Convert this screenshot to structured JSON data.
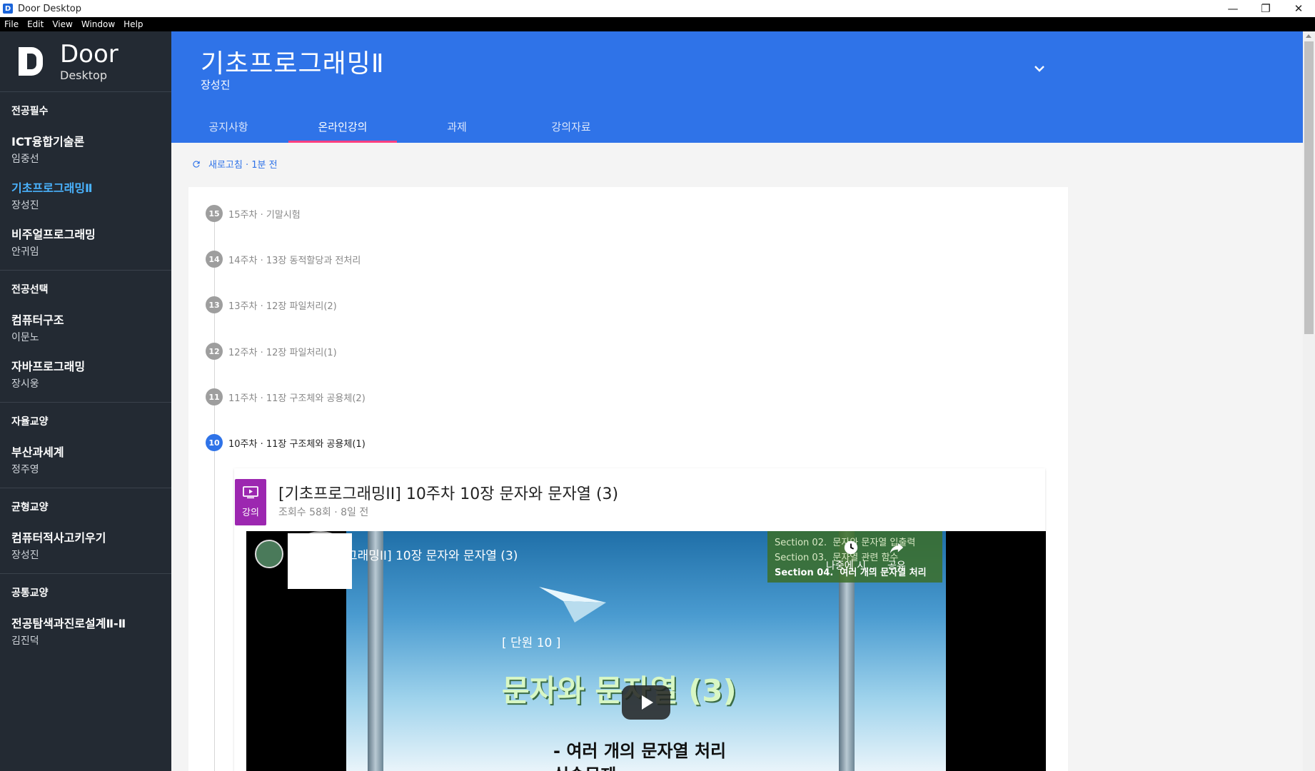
{
  "window": {
    "title": "Door Desktop",
    "icon_letter": "D",
    "controls": {
      "minimize": "—",
      "restore": "❐",
      "close": "✕"
    }
  },
  "menu": [
    "File",
    "Edit",
    "View",
    "Window",
    "Help"
  ],
  "brand": {
    "name": "Door",
    "sub": "Desktop"
  },
  "sidebar": {
    "groups": [
      {
        "title": "전공필수",
        "items": [
          {
            "name": "ICT융합기술론",
            "prof": "임중선"
          },
          {
            "name": "기초프로그래밍Ⅱ",
            "prof": "장성진",
            "active": true
          },
          {
            "name": "비주얼프로그래밍",
            "prof": "안귀임"
          }
        ]
      },
      {
        "title": "전공선택",
        "items": [
          {
            "name": "컴퓨터구조",
            "prof": "이문노"
          },
          {
            "name": "자바프로그래밍",
            "prof": "장시웅"
          }
        ]
      },
      {
        "title": "자율교양",
        "items": [
          {
            "name": "부산과세계",
            "prof": "정주영"
          }
        ]
      },
      {
        "title": "균형교양",
        "items": [
          {
            "name": "컴퓨터적사고키우기",
            "prof": "장성진"
          }
        ]
      },
      {
        "title": "공통교양",
        "items": [
          {
            "name": "전공탐색과진로설계Ⅱ-Ⅱ",
            "prof": "김진덕"
          }
        ]
      }
    ]
  },
  "header": {
    "title": "기초프로그래밍Ⅱ",
    "professor": "장성진",
    "tabs": [
      {
        "label": "공지사항"
      },
      {
        "label": "온라인강의",
        "active": true
      },
      {
        "label": "과제"
      },
      {
        "label": "강의자료"
      }
    ]
  },
  "refresh": {
    "label": "새로고침 · 1분 전"
  },
  "weeks": [
    {
      "num": "15",
      "label": "15주차 · 기말시험"
    },
    {
      "num": "14",
      "label": "14주차 · 13장 동적할당과 전처리"
    },
    {
      "num": "13",
      "label": "13주차 · 12장 파일처리(2)"
    },
    {
      "num": "12",
      "label": "12주차 · 12장 파일처리(1)"
    },
    {
      "num": "11",
      "label": "11주차 · 11장 구조체와 공용체(2)"
    },
    {
      "num": "10",
      "label": "10주차 · 11장 구조체와 공용체(1)",
      "active": true
    }
  ],
  "lecture": {
    "badge": "강의",
    "title": "[기초프로그래밍II] 10주차 10장 문자와 문자열 (3)",
    "meta": "조회수 58회 · 8일 전"
  },
  "video": {
    "title": "그래밍II] 10장 문자와 문자열 (3)",
    "watch_later": "나중에 시...",
    "share": "공유",
    "slide": {
      "sections": [
        {
          "no": "Section 02.",
          "text": "문자와 문자열 입출력"
        },
        {
          "no": "Section 03.",
          "text": "문자열 관련 함수"
        },
        {
          "no": "Section 04.",
          "text": "여러 개의 문자열 처리",
          "highlight": true
        }
      ],
      "unit": "[ 단원 10 ]",
      "heading": "문자와 문자열 (3)",
      "bullet": "-   여러 개의 문자열 처리",
      "bullet2": "실습문제"
    }
  }
}
